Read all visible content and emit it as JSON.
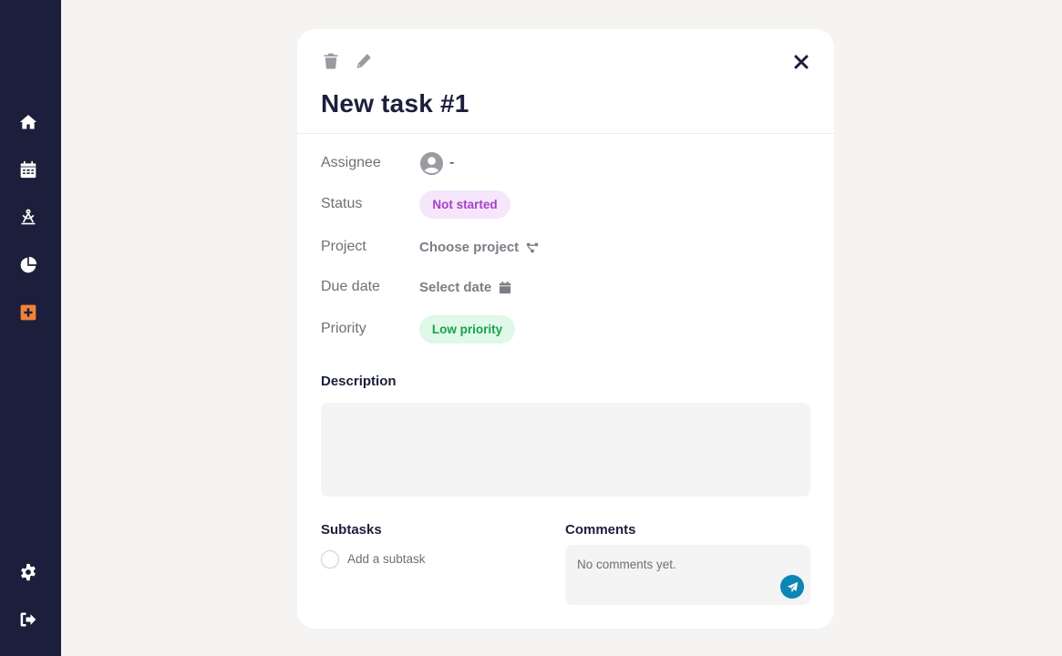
{
  "sidebar": {
    "items": [
      {
        "name": "home-icon"
      },
      {
        "name": "calendar-icon"
      },
      {
        "name": "compass-drafting-icon"
      },
      {
        "name": "pie-chart-icon"
      },
      {
        "name": "add-square-icon"
      }
    ],
    "bottom": [
      {
        "name": "gear-icon"
      },
      {
        "name": "sign-out-icon"
      }
    ],
    "active_color": "#f0833a",
    "background": "#1b1f3b"
  },
  "task": {
    "title": "New task #1",
    "fields": {
      "assignee_label": "Assignee",
      "assignee_value": "-",
      "status_label": "Status",
      "status_value": "Not started",
      "project_label": "Project",
      "project_value": "Choose project",
      "due_label": "Due date",
      "due_value": "Select date",
      "priority_label": "Priority",
      "priority_value": "Low priority"
    },
    "description_title": "Description",
    "description_value": "",
    "subtasks_title": "Subtasks",
    "subtask_placeholder": "Add a subtask",
    "comments_title": "Comments",
    "comments_empty": "No comments yet."
  },
  "colors": {
    "status_bg": "#f5e6fb",
    "status_text": "#a641c9",
    "priority_bg": "#dff8e8",
    "priority_text": "#16a34a",
    "send_button": "#0c86b3"
  }
}
